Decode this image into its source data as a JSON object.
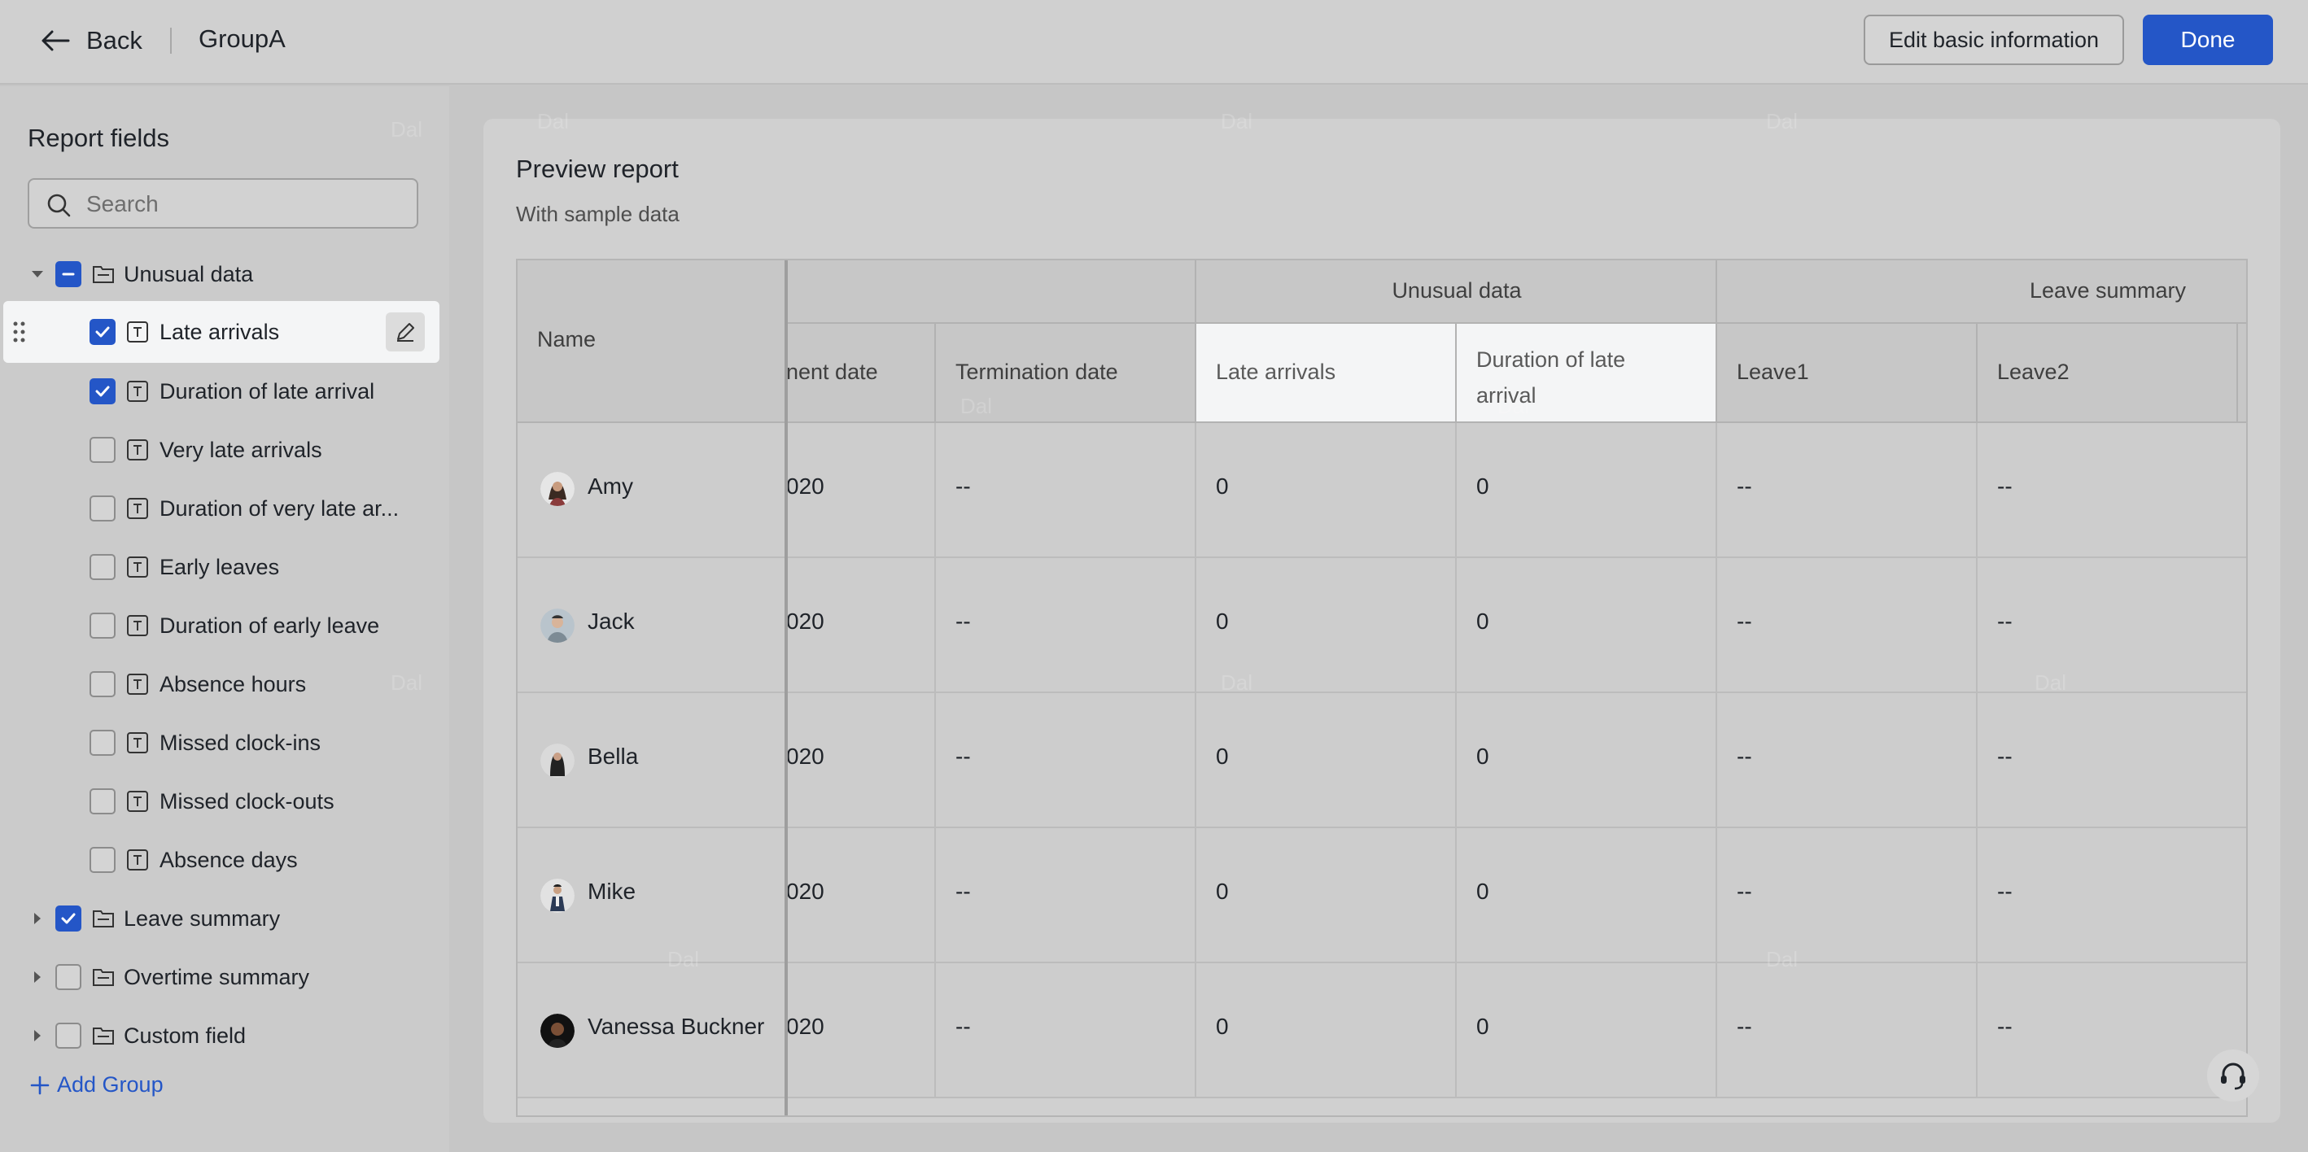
{
  "header": {
    "back_label": "Back",
    "group_title": "GroupA",
    "edit_basic_info_label": "Edit basic information",
    "done_label": "Done"
  },
  "sidebar": {
    "title": "Report fields",
    "search_placeholder": "Search",
    "groups": [
      {
        "label": "Unusual data",
        "expanded": true,
        "check_state": "partial",
        "fields": [
          {
            "label": "Late arrivals",
            "checked": true
          },
          {
            "label": "Duration of late arrival",
            "checked": true
          },
          {
            "label": "Very late arrivals",
            "checked": false
          },
          {
            "label": "Duration of very late ar...",
            "checked": false
          },
          {
            "label": "Early leaves",
            "checked": false
          },
          {
            "label": "Duration of early leave",
            "checked": false
          },
          {
            "label": "Absence hours",
            "checked": false
          },
          {
            "label": "Missed clock-ins",
            "checked": false
          },
          {
            "label": "Missed clock-outs",
            "checked": false
          },
          {
            "label": "Absence days",
            "checked": false
          }
        ]
      },
      {
        "label": "Leave summary",
        "expanded": false,
        "check_state": "checked"
      },
      {
        "label": "Overtime summary",
        "expanded": false,
        "check_state": "unchecked"
      },
      {
        "label": "Custom field",
        "expanded": false,
        "check_state": "unchecked"
      }
    ],
    "add_group_label": "Add Group"
  },
  "preview": {
    "title": "Preview report",
    "subtitle": "With sample data",
    "group_headers": {
      "unusual_data": "Unusual data",
      "leave_summary": "Leave summary"
    },
    "columns": {
      "name": "Name",
      "employment_date": "nent date",
      "termination_date": "Termination date",
      "late_arrivals": "Late arrivals",
      "duration_late": "Duration of late arrival",
      "leave1": "Leave1",
      "leave2": "Leave2"
    },
    "rows": [
      {
        "name": "Amy",
        "employment_date": "020",
        "termination_date": "--",
        "late_arrivals": "0",
        "duration_late": "0",
        "leave1": "--",
        "leave2": "--"
      },
      {
        "name": "Jack",
        "employment_date": "020",
        "termination_date": "--",
        "late_arrivals": "0",
        "duration_late": "0",
        "leave1": "--",
        "leave2": "--"
      },
      {
        "name": "Bella",
        "employment_date": "020",
        "termination_date": "--",
        "late_arrivals": "0",
        "duration_late": "0",
        "leave1": "--",
        "leave2": "--"
      },
      {
        "name": "Mike",
        "employment_date": "020",
        "termination_date": "--",
        "late_arrivals": "0",
        "duration_late": "0",
        "leave1": "--",
        "leave2": "--"
      },
      {
        "name": "Vanessa Buckner",
        "employment_date": "020",
        "termination_date": "--",
        "late_arrivals": "0",
        "duration_late": "0",
        "leave1": "--",
        "leave2": "--"
      }
    ]
  },
  "watermark_text": "Dal",
  "colors": {
    "accent": "#2456c7",
    "overlay": "#c6c6c6",
    "highlight": "#f4f5f6"
  }
}
